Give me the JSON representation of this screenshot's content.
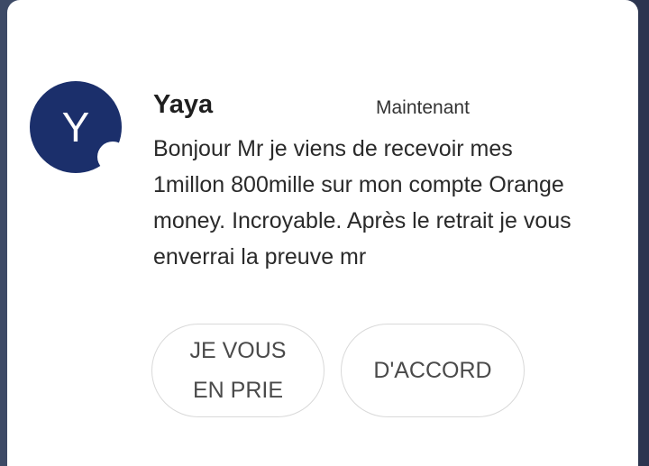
{
  "notification": {
    "avatar_letter": "Y",
    "sender": "Yaya",
    "timestamp": "Maintenant",
    "message": "Bonjour Mr je viens de recevoir mes 1millon 800mille sur mon compte Orange money. Incroyable. Après le retrait je vous enverrai la preuve mr",
    "colors": {
      "avatar_bg": "#1b2f6b",
      "card_bg": "#ffffff",
      "screen_bg": "#3d4a66"
    }
  },
  "actions": {
    "reply_line1": "JE VOUS",
    "reply_line2": "EN PRIE",
    "accept_label": "D'ACCORD"
  }
}
